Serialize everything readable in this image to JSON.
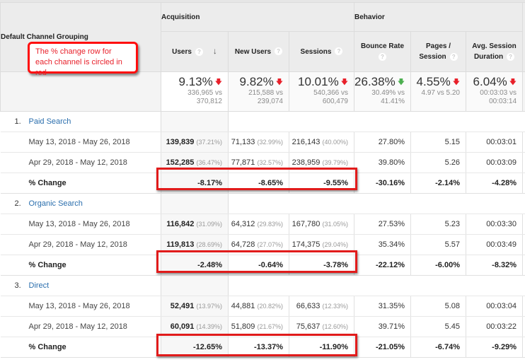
{
  "annotation": {
    "callout_text": "The % change row for each channel is circled in red",
    "highlight_color": "#e11b1b"
  },
  "header": {
    "dimension_label": "Default Channel Grouping",
    "groups": {
      "acquisition": "Acquisition",
      "behavior": "Behavior"
    },
    "columns": {
      "users": "Users",
      "new_users": "New Users",
      "sessions": "Sessions",
      "bounce_rate": "Bounce Rate",
      "pages_session_1": "Pages /",
      "pages_session_2": "Session",
      "avg_duration_1": "Avg. Session",
      "avg_duration_2": "Duration"
    },
    "help_icon": "?",
    "sort_icon": "↓"
  },
  "totals": {
    "users": {
      "change": "9.13%",
      "direction": "down-bad",
      "cmp1": "336,965 vs",
      "cmp2": "370,812"
    },
    "new_users": {
      "change": "9.82%",
      "direction": "down-bad",
      "cmp1": "215,588 vs",
      "cmp2": "239,074"
    },
    "sessions": {
      "change": "10.01%",
      "direction": "down-bad",
      "cmp1": "540,366 vs",
      "cmp2": "600,479"
    },
    "bounce_rate": {
      "change": "26.38%",
      "direction": "down-good",
      "cmp1": "30.49% vs",
      "cmp2": "41.41%"
    },
    "pages_session": {
      "change": "4.55%",
      "direction": "down-bad",
      "cmp1": "4.97 vs 5.20",
      "cmp2": ""
    },
    "avg_duration": {
      "change": "6.04%",
      "direction": "down-bad",
      "cmp1": "00:03:03 vs",
      "cmp2": "00:03:14"
    }
  },
  "arrow_glyph": "🡇",
  "colors": {
    "bad": "#e8202a",
    "good": "#4caf50",
    "link": "#2a6ead"
  },
  "channels": [
    {
      "index": "1.",
      "name": "Paid Search",
      "rows": [
        {
          "label": "May 13, 2018 - May 26, 2018",
          "users": "139,839",
          "users_pct": "(37.21%)",
          "new_users": "71,133",
          "new_users_pct": "(32.99%)",
          "sessions": "216,143",
          "sessions_pct": "(40.00%)",
          "bounce_rate": "27.80%",
          "pages_session": "5.15",
          "avg_duration": "00:03:01"
        },
        {
          "label": "Apr 29, 2018 - May 12, 2018",
          "users": "152,285",
          "users_pct": "(36.47%)",
          "new_users": "77,871",
          "new_users_pct": "(32.57%)",
          "sessions": "238,959",
          "sessions_pct": "(39.79%)",
          "bounce_rate": "39.80%",
          "pages_session": "5.26",
          "avg_duration": "00:03:09"
        }
      ],
      "change": {
        "label": "% Change",
        "users": "-8.17%",
        "new_users": "-8.65%",
        "sessions": "-9.55%",
        "bounce_rate": "-30.16%",
        "pages_session": "-2.14%",
        "avg_duration": "-4.28%"
      }
    },
    {
      "index": "2.",
      "name": "Organic Search",
      "rows": [
        {
          "label": "May 13, 2018 - May 26, 2018",
          "users": "116,842",
          "users_pct": "(31.09%)",
          "new_users": "64,312",
          "new_users_pct": "(29.83%)",
          "sessions": "167,780",
          "sessions_pct": "(31.05%)",
          "bounce_rate": "27.53%",
          "pages_session": "5.23",
          "avg_duration": "00:03:30"
        },
        {
          "label": "Apr 29, 2018 - May 12, 2018",
          "users": "119,813",
          "users_pct": "(28.69%)",
          "new_users": "64,728",
          "new_users_pct": "(27.07%)",
          "sessions": "174,375",
          "sessions_pct": "(29.04%)",
          "bounce_rate": "35.34%",
          "pages_session": "5.57",
          "avg_duration": "00:03:49"
        }
      ],
      "change": {
        "label": "% Change",
        "users": "-2.48%",
        "new_users": "-0.64%",
        "sessions": "-3.78%",
        "bounce_rate": "-22.12%",
        "pages_session": "-6.00%",
        "avg_duration": "-8.32%"
      }
    },
    {
      "index": "3.",
      "name": "Direct",
      "rows": [
        {
          "label": "May 13, 2018 - May 26, 2018",
          "users": "52,491",
          "users_pct": "(13.97%)",
          "new_users": "44,881",
          "new_users_pct": "(20.82%)",
          "sessions": "66,633",
          "sessions_pct": "(12.33%)",
          "bounce_rate": "31.35%",
          "pages_session": "5.08",
          "avg_duration": "00:03:04"
        },
        {
          "label": "Apr 29, 2018 - May 12, 2018",
          "users": "60,091",
          "users_pct": "(14.39%)",
          "new_users": "51,809",
          "new_users_pct": "(21.67%)",
          "sessions": "75,637",
          "sessions_pct": "(12.60%)",
          "bounce_rate": "39.71%",
          "pages_session": "5.45",
          "avg_duration": "00:03:22"
        }
      ],
      "change": {
        "label": "% Change",
        "users": "-12.65%",
        "new_users": "-13.37%",
        "sessions": "-11.90%",
        "bounce_rate": "-21.05%",
        "pages_session": "-6.74%",
        "avg_duration": "-9.29%"
      }
    }
  ]
}
